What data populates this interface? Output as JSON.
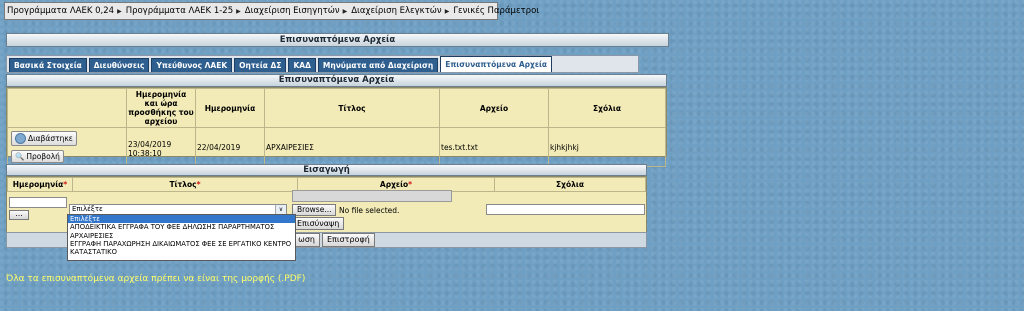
{
  "menu": {
    "items": [
      {
        "label": "Προγράμματα ΛΑΕΚ 0,24"
      },
      {
        "label": "Προγράμματα ΛΑΕΚ 1-25"
      },
      {
        "label": "Διαχείριση Εισηγητών"
      },
      {
        "label": "Διαχείριση Ελεγκτών"
      },
      {
        "label": "Γενικές Παράμετροι"
      }
    ]
  },
  "page": {
    "title": "Επισυναπτόμενα Αρχεία"
  },
  "tabs": [
    {
      "label": "Βασικά Στοιχεία"
    },
    {
      "label": "Διευθύνσεις"
    },
    {
      "label": "Υπεύθυνος ΛΑΕΚ"
    },
    {
      "label": "Οητεία ΔΣ"
    },
    {
      "label": "ΚΑΔ"
    },
    {
      "label": "Μηνύματα από Διαχείριση"
    },
    {
      "label": "Επισυναπτόμενα Αρχεία"
    }
  ],
  "attachments": {
    "title": "Επισυναπτόμενα Αρχεία",
    "headers": {
      "upload_date": "Ημερομηνία και ώρα προσθήκης του αρχείου",
      "date": "Ημερομηνία",
      "title": "Τίτλος",
      "file": "Αρχείο",
      "comments": "Σχόλια"
    },
    "rows": [
      {
        "read_btn": "Διαβάστηκε",
        "view_btn": "Προβολή",
        "upload_date": "23/04/2019",
        "upload_time": "10:38:10",
        "date": "22/04/2019",
        "title": "ΑΡΧΑΙΡΕΣΙΕΣ",
        "file": "tes.txt.txt",
        "comments": "kjhkjhkj"
      }
    ]
  },
  "insert": {
    "title": "Εισαγωγή",
    "headers": {
      "date": "Ημερομηνία",
      "title": "Τίτλος",
      "file": "Αρχείο",
      "comments": "Σχόλια"
    },
    "required_mark": "*",
    "date_btn": "...",
    "select_value": "Επιλέξτε",
    "browse_btn": "Browse...",
    "file_status": "No file selected.",
    "attach_btn": "Επισύναψη",
    "save_btn_partial": "ωση",
    "back_btn": "Επιστροφή",
    "options": [
      "Επιλέξτε",
      "ΑΠΟΔΕΙΚΤΙΚΑ ΕΓΓΡΑΦΑ ΤΟΥ ΦΕΕ ΔΗΛΩΣΗΣ ΠΑΡΑΡΤΗΜΑΤΟΣ",
      "ΑΡΧΑΙΡΕΣΙΕΣ",
      "ΕΓΓΡΑΦΗ ΠΑΡΑΧΩΡΗΣΗ ΔΙΚΑΙΩΜΑΤΟΣ ΦΕΕ ΣΕ ΕΡΓΑΤΙΚΟ ΚΕΝΤΡΟ",
      "ΚΑΤΑΣΤΑΤΙΚΟ"
    ]
  },
  "note": "Όλα τα επισυναπτόμενα αρχεία πρέπει να είναι της μορφής (.PDF)"
}
